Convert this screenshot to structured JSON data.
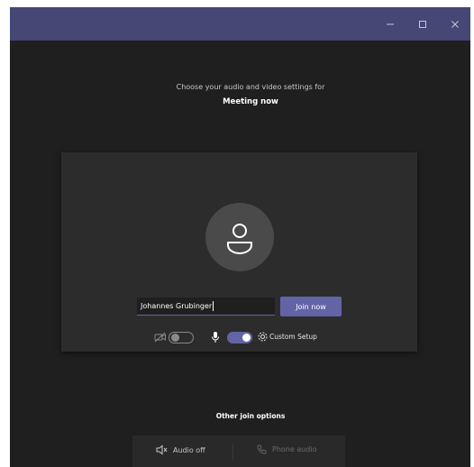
{
  "window": {
    "titlebar_color": "#464775",
    "controls": {
      "minimize_icon": "minimize-icon",
      "maximize_icon": "maximize-icon",
      "close_icon": "close-icon"
    }
  },
  "prejoin": {
    "choose_text": "Choose your audio and video settings for",
    "meeting_title": "Meeting now",
    "name_input_value": "Johannes Grubinger",
    "join_label": "Join now",
    "video_toggle_on": false,
    "mic_toggle_on": true,
    "custom_setup_label": "Custom Setup"
  },
  "other_join": {
    "heading": "Other join options",
    "audio_off_label": "Audio off",
    "phone_audio_label": "Phone audio"
  },
  "colors": {
    "accent": "#6264a7",
    "background": "#1f1f1f",
    "panel": "#2d2c2c"
  }
}
